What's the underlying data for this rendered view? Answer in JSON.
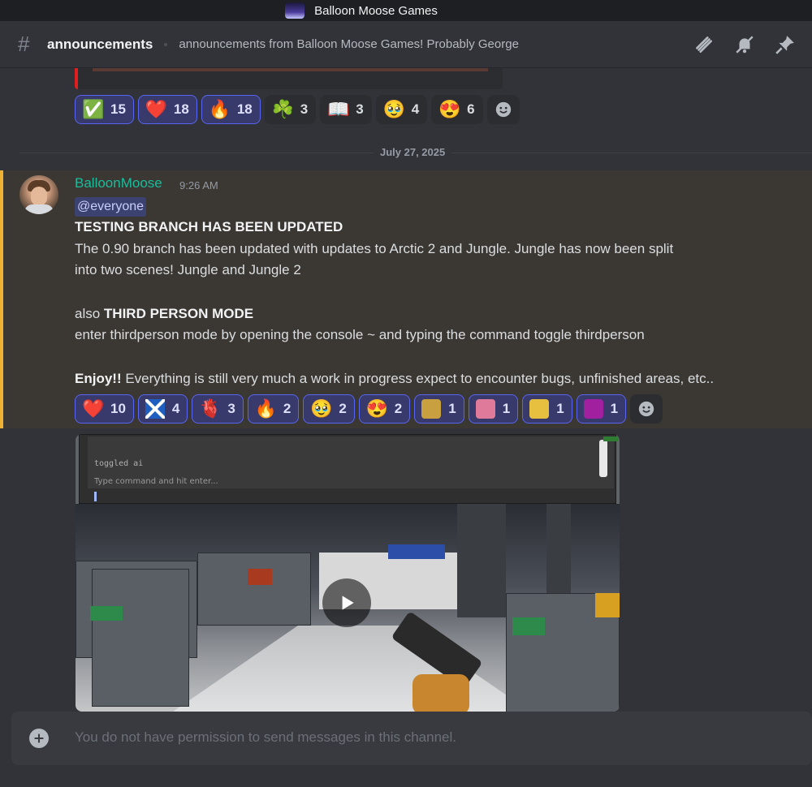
{
  "window": {
    "server_name": "Balloon Moose Games"
  },
  "channel": {
    "name": "announcements",
    "topic": "announcements from Balloon Moose Games! Probably George",
    "header_icons": [
      "threads-icon",
      "mute-bell-icon",
      "pin-icon"
    ]
  },
  "previous_reactions": [
    {
      "emoji": "✅",
      "name": "check-mark",
      "count": "15",
      "me": true
    },
    {
      "emoji": "❤️",
      "name": "red-heart",
      "count": "18",
      "me": true
    },
    {
      "emoji": "🔥",
      "name": "fire",
      "count": "18",
      "me": true
    },
    {
      "emoji": "☘️",
      "name": "shamrock",
      "count": "3",
      "me": false
    },
    {
      "emoji": "📖",
      "name": "open-book",
      "count": "3",
      "me": false
    },
    {
      "emoji": "🥹",
      "name": "pleading-face",
      "count": "4",
      "me": false
    },
    {
      "emoji": "😍",
      "name": "heart-eyes",
      "count": "6",
      "me": false
    }
  ],
  "date_divider": "July 27, 2025",
  "message": {
    "author": "BalloonMoose",
    "timestamp": "9:26 AM",
    "mention": "@everyone",
    "heading": "TESTING BRANCH HAS BEEN UPDATED",
    "line1": "The 0.90 branch has been updated with updates to Arctic 2 and Jungle. Jungle has now been split",
    "line2": "into two scenes! Jungle and Jungle 2",
    "also_prefix": "also ",
    "also_bold": "THIRD PERSON MODE",
    "line3": "enter thirdperson mode by opening the console ~ and typing the command toggle thirdperson",
    "enjoy_bold": "Enjoy!!",
    "enjoy_rest": "  Everything is still very much a work in progress expect to encounter bugs, unfinished areas, etc.."
  },
  "message_reactions": [
    {
      "emoji": "❤️",
      "name": "red-heart",
      "count": "10",
      "me": true
    },
    {
      "emoji": "🏴",
      "name": "scotland-flag",
      "count": "4",
      "me": true,
      "custom": "#1f5fbf"
    },
    {
      "emoji": "🫀",
      "name": "anatomical-heart",
      "count": "3",
      "me": true
    },
    {
      "emoji": "🔥",
      "name": "fire",
      "count": "2",
      "me": true
    },
    {
      "emoji": "🥹",
      "name": "pleading-face",
      "count": "2",
      "me": true
    },
    {
      "emoji": "😍",
      "name": "heart-eyes",
      "count": "2",
      "me": true
    },
    {
      "emoji": "",
      "name": "custom-emoji-1",
      "count": "1",
      "me": true,
      "custom": "#c8a040"
    },
    {
      "emoji": "",
      "name": "custom-emoji-2",
      "count": "1",
      "me": true,
      "custom": "#e07a9a"
    },
    {
      "emoji": "",
      "name": "custom-emoji-3",
      "count": "1",
      "me": true,
      "custom": "#e8c040"
    },
    {
      "emoji": "",
      "name": "custom-emoji-4",
      "count": "1",
      "me": true,
      "custom": "#a020a0"
    }
  ],
  "video": {
    "console_log": "toggled ai",
    "console_placeholder": "Type command and hit enter..."
  },
  "composer": {
    "placeholder": "You do not have permission to send messages in this channel."
  },
  "colors": {
    "author": "#1abc9c",
    "mention_bg": "#3c4270",
    "highlight_border": "#f0b232",
    "reaction_me_border": "#5865f2"
  }
}
